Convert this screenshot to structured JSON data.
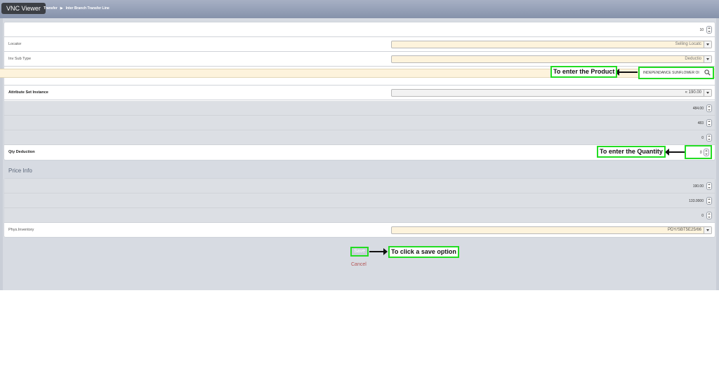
{
  "window": {
    "badge": "VNC Viewer"
  },
  "breadcrumb": {
    "items": [
      "Transfer",
      "Inter Branch Transfer Line"
    ]
  },
  "fields": {
    "top_qty": {
      "value": "10"
    },
    "locator": {
      "label": "Locator",
      "value": "Selling Locatc"
    },
    "inv_sub_type": {
      "label": "Inv Sub Type",
      "value": "Deductio"
    },
    "product": {
      "value": "INDEPENDANCE SUNFLOWER OI"
    },
    "attribute_set_instance": {
      "label": "Attribute Set Instance",
      "value": "« 190.00"
    },
    "gray_row_1": {
      "value": "484.00"
    },
    "gray_row_2": {
      "value": "483"
    },
    "gray_row_3": {
      "value": "0"
    },
    "qty_deduction": {
      "label": "Qty Deduction",
      "value": "8"
    }
  },
  "price_info": {
    "title": "Price Info",
    "row_1": {
      "value": "190.00"
    },
    "row_2": {
      "value": "133.0000"
    },
    "row_3": {
      "value": "0"
    },
    "phys_inventory": {
      "label": "Phys.Inventory",
      "value": "PDY/SBT5E25/66"
    }
  },
  "actions": {
    "save": "Save",
    "cancel": "Cancel"
  },
  "annotations": {
    "product": "To enter the Product",
    "quantity": "To enter the Quantity",
    "save": "To click a save option"
  },
  "colors": {
    "highlight": "#22dd22",
    "mandatory_bg": "#fdf3dc",
    "content_bg": "#d7dbe2"
  }
}
